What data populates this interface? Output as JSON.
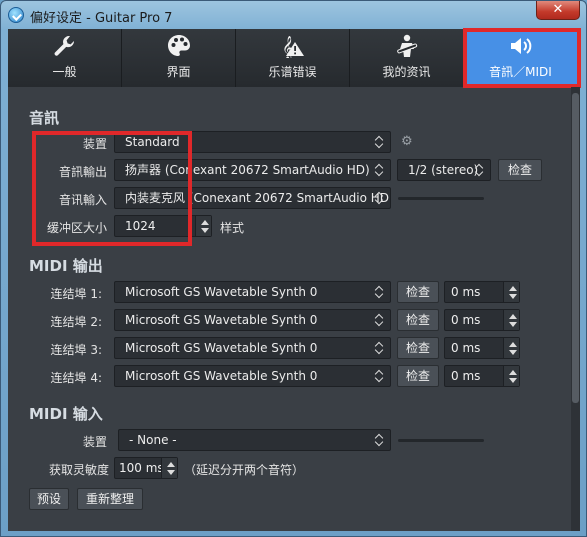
{
  "window": {
    "title": "偏好设定 - Guitar Pro 7",
    "close_label": "✕"
  },
  "tabs": [
    {
      "label": "一般",
      "icon": "wrench-icon"
    },
    {
      "label": "界面",
      "icon": "palette-icon"
    },
    {
      "label": "乐谱错误",
      "icon": "score-warning-icon"
    },
    {
      "label": "我的资讯",
      "icon": "guitarist-icon"
    },
    {
      "label": "音訊／MIDI",
      "icon": "speaker-icon",
      "active": true
    }
  ],
  "audio": {
    "section_title": "音訊",
    "device_label": "装置",
    "device_value": "Standard",
    "output_label": "音訊輸出",
    "output_value": "扬声器 (Conexant 20672 SmartAudio HD)",
    "channel_value": "1/2 (stereo)",
    "output_check": "检查",
    "input_label": "音讯輸入",
    "input_value": "内装麦克风 (Conexant 20672 SmartAudio HD)",
    "buffer_label": "缓冲区大小",
    "buffer_value": "1024",
    "style_label": "样式"
  },
  "midi_out": {
    "section_title": "MIDI 输出",
    "ports": [
      {
        "label": "连结埠 1:",
        "device": "Microsoft GS Wavetable Synth 0",
        "check": "检查",
        "latency": "0 ms"
      },
      {
        "label": "连结埠 2:",
        "device": "Microsoft GS Wavetable Synth 0",
        "check": "检查",
        "latency": "0 ms"
      },
      {
        "label": "连结埠 3:",
        "device": "Microsoft GS Wavetable Synth 0",
        "check": "检查",
        "latency": "0 ms"
      },
      {
        "label": "连结埠 4:",
        "device": "Microsoft GS Wavetable Synth 0",
        "check": "检查",
        "latency": "0 ms"
      }
    ]
  },
  "midi_in": {
    "section_title": "MIDI 输入",
    "device_label": "装置",
    "device_value": "- None -",
    "sensitivity_label": "获取灵敏度",
    "sensitivity_value": "100 ms",
    "sensitivity_note": "（延迟分开两个音符）"
  },
  "footer": {
    "preset_button": "预设",
    "reset_button": "重新整理"
  },
  "colors": {
    "accent": "#4790e6",
    "highlight_box": "#e0282a",
    "panel_bg": "#3a3f45"
  }
}
